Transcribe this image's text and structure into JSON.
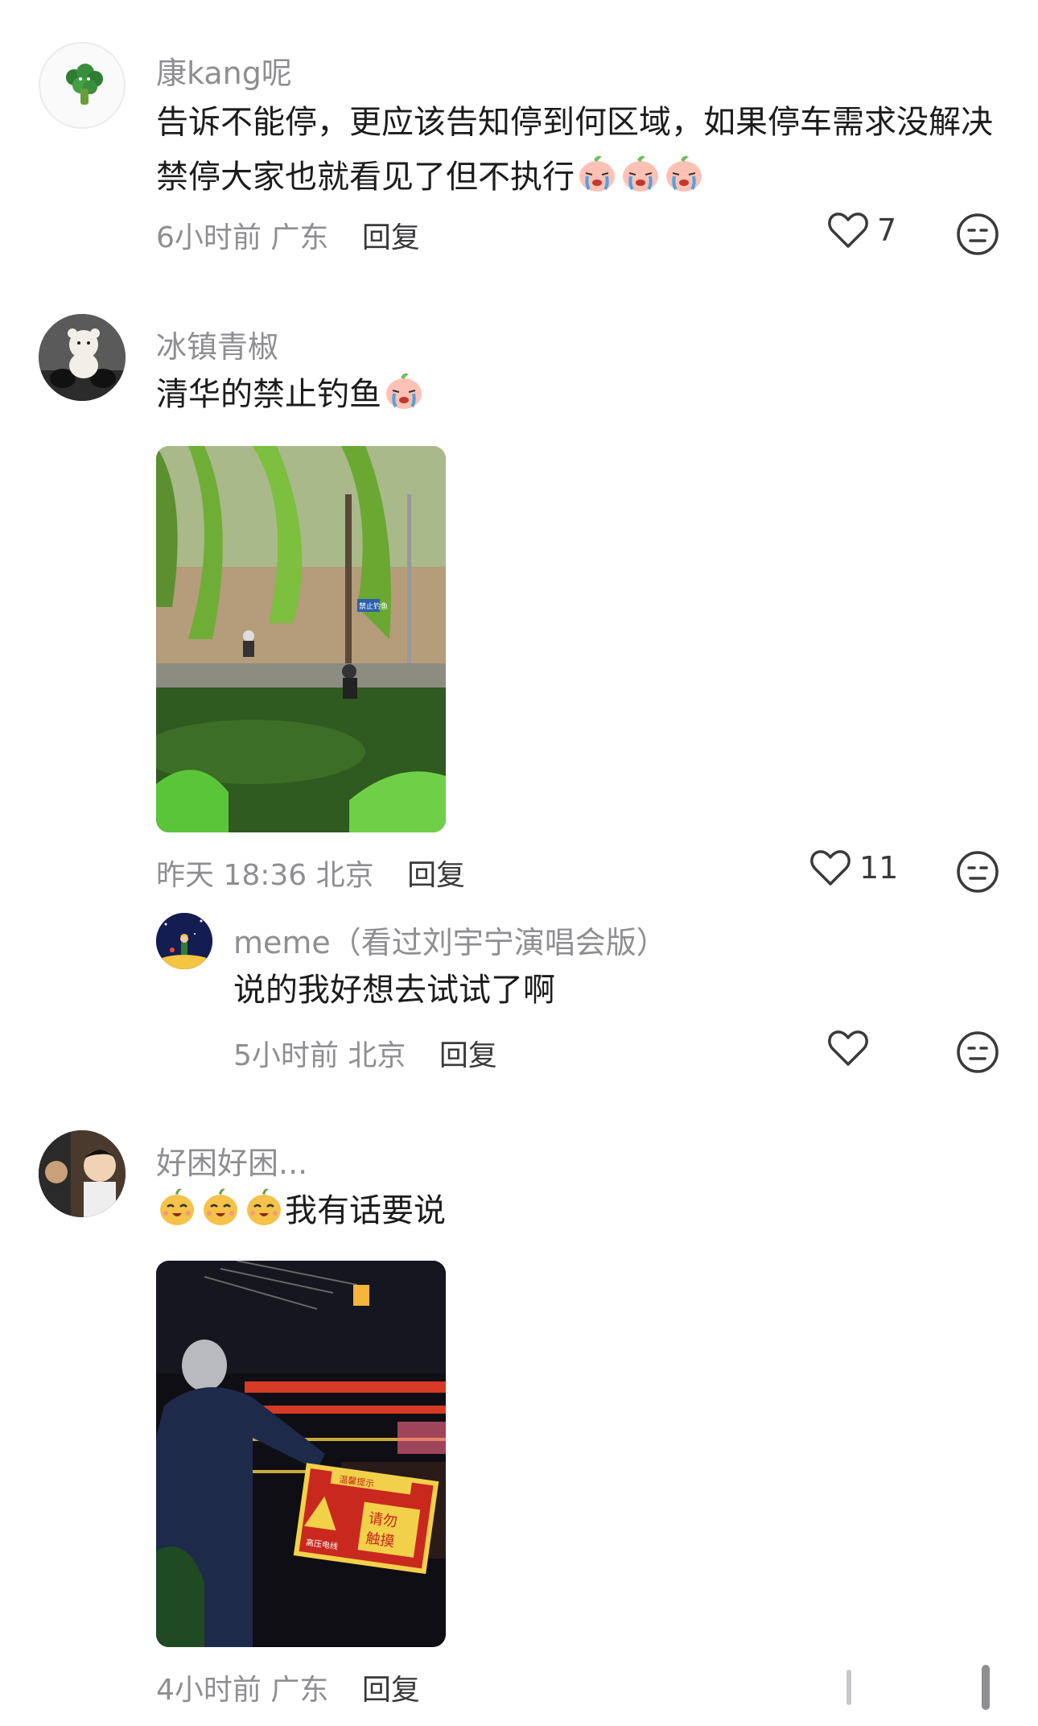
{
  "comments": [
    {
      "username": "康kang呢",
      "text": "告诉不能停，更应该告知停到何区域，如果停车需求没解决禁停大家也就看见了但不执行",
      "time": "6小时前",
      "location": "广东",
      "reply_label": "回复",
      "likes": "7"
    },
    {
      "username": "冰镇青椒",
      "text": "清华的禁止钓鱼",
      "time": "昨天 18:36",
      "location": "北京",
      "reply_label": "回复",
      "likes": "11",
      "photo_sign": "禁止钓鱼",
      "reply": {
        "username": "meme（看过刘宇宁演唱会版）",
        "text": "说的我好想去试试了啊",
        "time": "5小时前",
        "location": "北京",
        "reply_label": "回复"
      }
    },
    {
      "username": "好困好困...",
      "text": "我有话要说",
      "reply_label": "回复",
      "time": "4小时前",
      "location": "广东",
      "photo_sign": {
        "header": "温馨提示",
        "line1": "高压电线",
        "line2": "请勿",
        "line3": "触摸"
      }
    }
  ],
  "icons": {
    "like": "heart-outline-icon",
    "emoji_react": "neutral-face-icon",
    "crying_sticker": "crying-peach-sticker",
    "laughing_sticker": "pear-face-sticker"
  },
  "colors": {
    "primary_text": "#1c1c1e",
    "secondary_text": "#8e8e93",
    "icon": "#3a3a3c"
  }
}
